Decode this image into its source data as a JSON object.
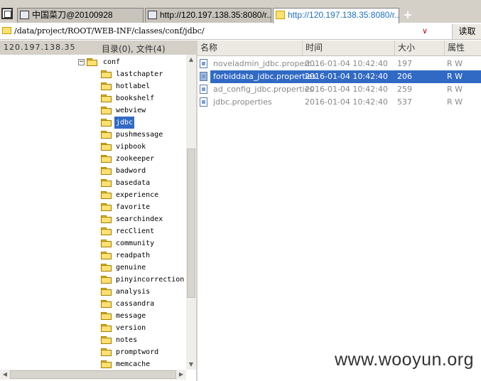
{
  "tabs": [
    {
      "label": "中国菜刀@20100928",
      "active": false
    },
    {
      "label": "http://120.197.138.35:8080/r...",
      "active": false
    },
    {
      "label": "http://120.197.138.35:8080/r...",
      "active": true
    }
  ],
  "new_tab_symbol": "+",
  "address": {
    "path": "/data/project/ROOT/WEB-INF/classes/conf/jdbc/",
    "dropdown_symbol": "∨",
    "read_button": "读取"
  },
  "left_header": {
    "host": "120.197.138.35",
    "count": "目录(0), 文件(4)"
  },
  "tree": {
    "expander": "−",
    "root": "conf",
    "children": [
      "lastchapter",
      "hotlabel",
      "bookshelf",
      "webview",
      "jdbc",
      "pushmessage",
      "vipbook",
      "zookeeper",
      "badword",
      "basedata",
      "experience",
      "favorite",
      "searchindex",
      "recClient",
      "community",
      "readpath",
      "genuine",
      "pinyincorrection",
      "analysis",
      "cassandra",
      "message",
      "version",
      "notes",
      "promptword",
      "memcache"
    ],
    "selected": "jdbc"
  },
  "columns": {
    "name": "名称",
    "time": "时间",
    "size": "大小",
    "attr": "属性"
  },
  "files": [
    {
      "name": "noveladmin_jdbc.propert...",
      "time": "2016-01-04 10:42:40",
      "size": "197",
      "attr": "R W",
      "selected": false
    },
    {
      "name": "forbiddata_jdbc.properties",
      "time": "2016-01-04 10:42:40",
      "size": "206",
      "attr": "R W",
      "selected": true
    },
    {
      "name": "ad_config_jdbc.properties",
      "time": "2016-01-04 10:42:40",
      "size": "259",
      "attr": "R W",
      "selected": false
    },
    {
      "name": "jdbc.properties",
      "time": "2016-01-04 10:42:40",
      "size": "537",
      "attr": "R W",
      "selected": false
    }
  ],
  "watermark": "www.wooyun.org",
  "colors": {
    "selection": "#316ac5",
    "folder": "#ffe070",
    "active_tab_text": "#1d6fc7"
  }
}
